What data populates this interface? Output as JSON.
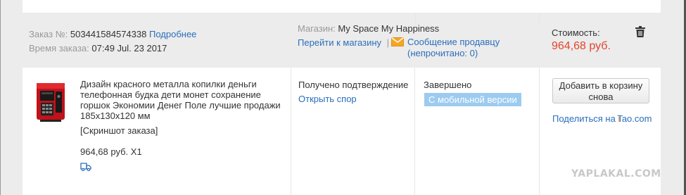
{
  "order": {
    "number_label": "Заказ №:",
    "number_value": "503441584574338",
    "details_link": "Подробнее",
    "time_label": "Время заказа:",
    "time_value": "07:49 Jul. 23 2017"
  },
  "store": {
    "label": "Магазин:",
    "name": "My Space My Happiness",
    "go_to_store": "Перейти к магазину",
    "separator": "|",
    "message_seller": "Сообщение продавцу",
    "unread": "(непрочитано: 0)"
  },
  "cost": {
    "label": "Стоимость:",
    "value": "964,68 руб."
  },
  "product": {
    "title_lines": [
      "Дизайн красного металла копилки деньги",
      "телефонная будка дети монет сохранение",
      "горшок Экономии Денег Поле лучшие продажи",
      "185x130x120 мм"
    ],
    "snapshot": "[Скриншот заказа]",
    "price_qty": "964,68 руб. X1"
  },
  "status": {
    "confirmation": "Получено подтверждение",
    "open_dispute": "Открыть спор",
    "completed": "Завершено",
    "mobile_badge": "С мобильной версии"
  },
  "actions": {
    "add_to_cart_line1": "Добавить в корзину",
    "add_to_cart_line2": "снова",
    "share_prefix": "Поделиться на",
    "share_i": "i",
    "share_tao": "Tao.com"
  },
  "watermark": "YAPLAKAL.COM",
  "colors": {
    "link": "#2a6ebb",
    "price": "#e2452b",
    "badge": "#9ccbf0",
    "header_bg": "#ececec",
    "share_orange": "#f08a24",
    "mail_icon": "#f5a623"
  },
  "icons": [
    "trash-icon",
    "mail-icon",
    "product-image",
    "shipping-icon"
  ]
}
